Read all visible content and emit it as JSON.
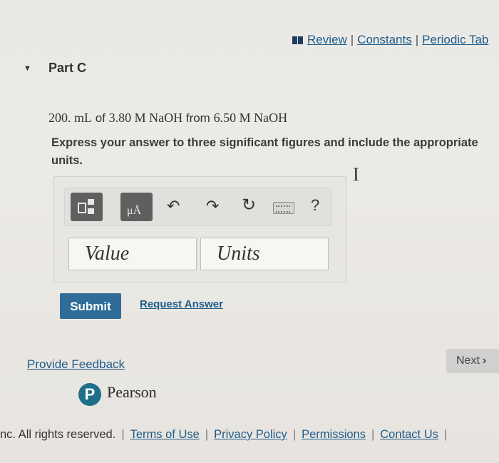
{
  "toplinks": {
    "review": "Review",
    "constants": "Constants",
    "periodic_table": "Periodic Tab",
    "separator": "|"
  },
  "part": {
    "title": "Part C",
    "toggle_icon": "triangle-down"
  },
  "question": {
    "volume": "200. mL",
    "of": " of ",
    "conc1": "3.80 M NaOH",
    "from": " from ",
    "conc2": "6.50 M NaOH"
  },
  "instructions": "Express your answer to three significant figures and include the appropriate units.",
  "toolbar": {
    "unit_button": "μÅ",
    "help": "?"
  },
  "inputs": {
    "value_placeholder": "Value",
    "units_placeholder": "Units"
  },
  "actions": {
    "submit": "Submit",
    "request_answer": "Request Answer"
  },
  "feedback": "Provide Feedback",
  "next": {
    "label": "Next",
    "chevron": "›"
  },
  "brand": {
    "mark": "P",
    "name": "Pearson",
    "color": "#1f6f8b"
  },
  "footer": {
    "rights": "nc. All rights reserved.",
    "terms": "Terms of Use",
    "privacy": "Privacy Policy",
    "permissions": "Permissions",
    "contact": "Contact Us",
    "separator": "|"
  },
  "colors": {
    "accent": "#2f6d98",
    "link": "#1e5c8a"
  }
}
